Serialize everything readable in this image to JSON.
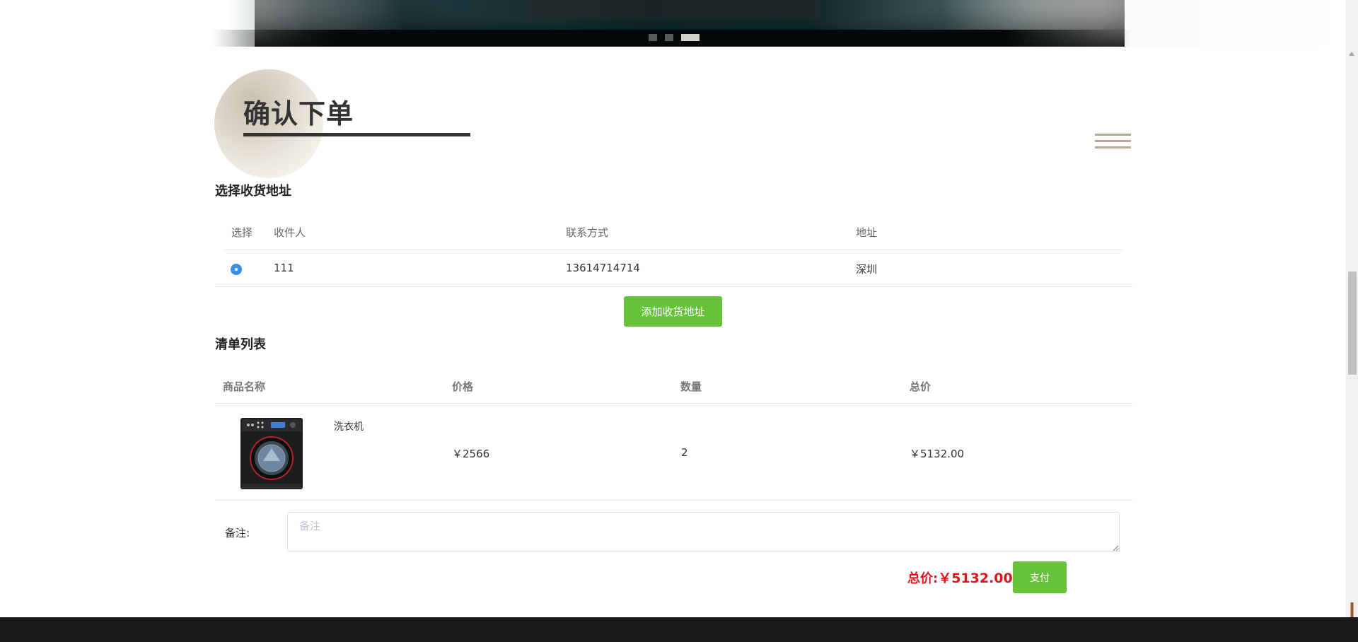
{
  "page": {
    "title": "确认下单"
  },
  "address_section": {
    "title": "选择收货地址",
    "columns": {
      "select": "选择",
      "receiver": "收件人",
      "contact": "联系方式",
      "address": "地址"
    },
    "rows": [
      {
        "selected": true,
        "receiver": "111",
        "contact": "13614714714",
        "address": "深圳"
      }
    ],
    "add_button": "添加收货地址"
  },
  "cart_section": {
    "title": "清单列表",
    "columns": {
      "name": "商品名称",
      "price": "价格",
      "quantity": "数量",
      "total": "总价"
    },
    "items": [
      {
        "name": "洗衣机",
        "price": "￥2566",
        "quantity": "2",
        "total": "￥5132.00",
        "image_icon": "washing-machine-image"
      }
    ]
  },
  "remark": {
    "label": "备注:",
    "placeholder": "备注",
    "value": ""
  },
  "summary": {
    "total_label": "总价:",
    "total_value": "￥5132.00",
    "pay_button": "支付"
  },
  "banner": {
    "slide_count": 3,
    "active_slide": 3
  },
  "colors": {
    "accent_green": "#67c23a",
    "radio_blue": "#3a8ee6",
    "total_red": "#e0141b",
    "title_dark": "#333333"
  }
}
